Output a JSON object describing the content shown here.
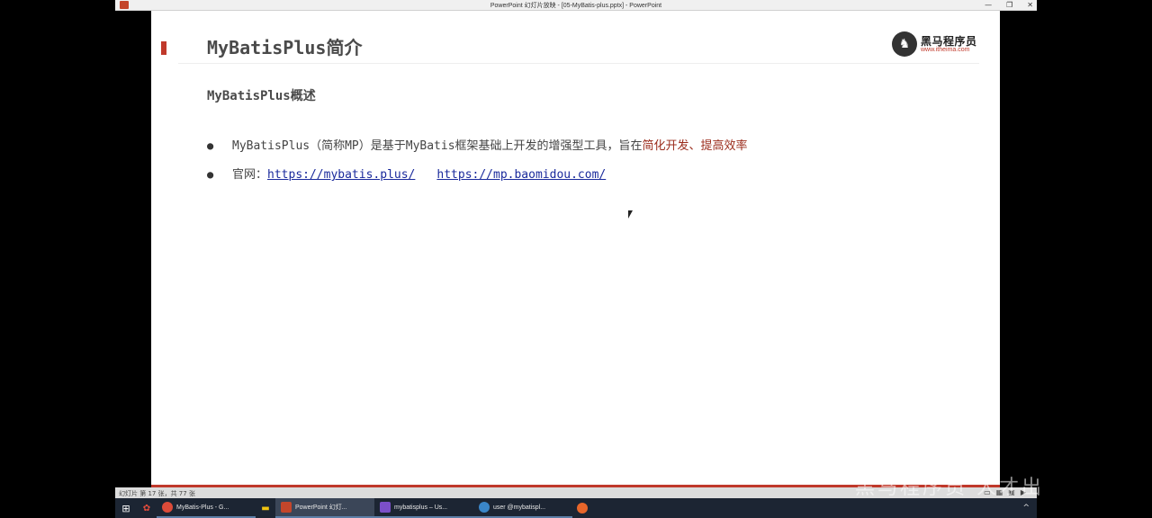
{
  "window": {
    "title": "PowerPoint 幻灯片放映 - [05-MyBatis-plus.pptx] - PowerPoint",
    "controls": [
      "—",
      "❐",
      "✕"
    ]
  },
  "slide": {
    "title": "MyBatisPlus简介",
    "subheading": "MyBatisPlus概述",
    "bullet1_text": "MyBatisPlus（简称MP）是基于MyBatis框架基础上开发的增强型工具，旨在",
    "bullet1_highlight": "简化开发、提高效率",
    "bullet2_label": "官网：",
    "link1": "https://mybatis.plus/",
    "link2": "https://mp.baomidou.com/",
    "accent_color": "#c0392b",
    "link_color": "#1a2a9c"
  },
  "logo": {
    "name_cn": "黑马程序员",
    "url": "www.itheima.com"
  },
  "statusbar": {
    "text": "幻灯片 第 17 张，共 77 张"
  },
  "watermark": "黑马程序员 人才出",
  "taskbar": {
    "items": [
      {
        "label": "MyBatis-Plus - G...",
        "color": "#dd4b39"
      },
      {
        "label": "PowerPoint 幻灯...",
        "color": "#c4462b"
      },
      {
        "label": "mybatisplus – Us...",
        "color": "#7b4fc8"
      },
      {
        "label": "user @mybatispl...",
        "color": "#3a86c8"
      }
    ]
  }
}
